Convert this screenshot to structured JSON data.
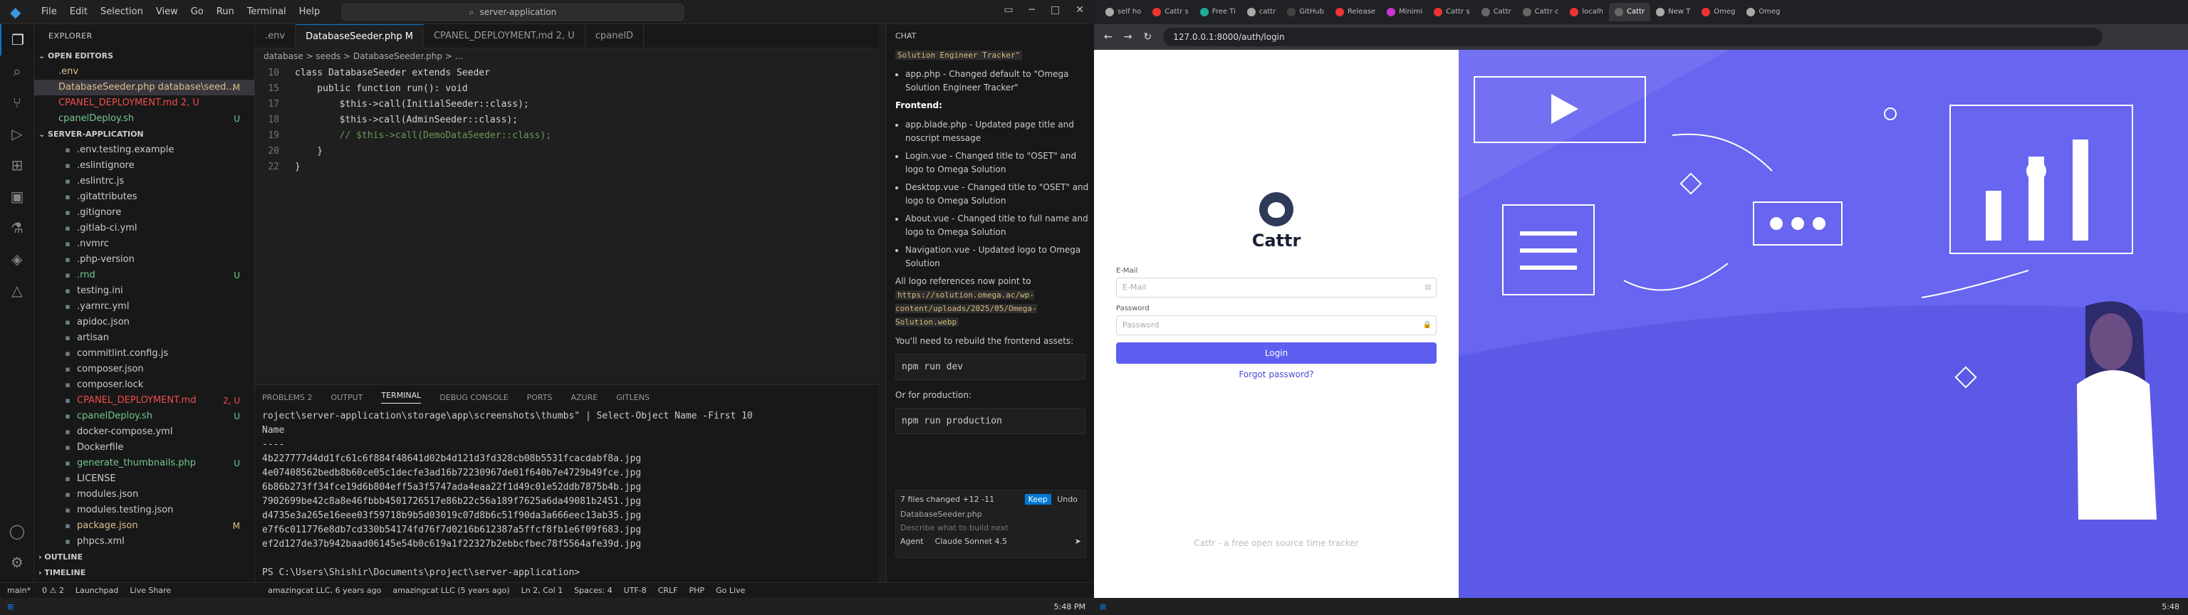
{
  "vscode": {
    "search": "server-application",
    "menu": [
      "File",
      "Edit",
      "Selection",
      "View",
      "Go",
      "Run",
      "Terminal",
      "Help"
    ],
    "explorer_title": "EXPLORER",
    "open_editors_label": "OPEN EDITORS",
    "open_editors": [
      {
        "name": ".env",
        "badge": "",
        "color": "#e2c08d"
      },
      {
        "name": "DatabaseSeeder.php database\\seed...",
        "badge": "M",
        "color": "#e2c08d",
        "selected": true
      },
      {
        "name": "CPANEL_DEPLOYMENT.md 2, U",
        "badge": "",
        "color": "#f14c4c"
      },
      {
        "name": "cpanelDeploy.sh",
        "badge": "U",
        "color": "#73c991"
      }
    ],
    "project_label": "SERVER-APPLICATION",
    "files": [
      {
        "name": ".env.testing.example",
        "badge": "",
        "color": "#ccc"
      },
      {
        "name": ".eslintignore",
        "badge": "",
        "color": "#ccc"
      },
      {
        "name": ".eslintrc.js",
        "badge": "",
        "color": "#ccc"
      },
      {
        "name": ".gitattributes",
        "badge": "",
        "color": "#ccc"
      },
      {
        "name": ".gitignore",
        "badge": "",
        "color": "#ccc"
      },
      {
        "name": ".gitlab-ci.yml",
        "badge": "",
        "color": "#ccc"
      },
      {
        "name": ".nvmrc",
        "badge": "",
        "color": "#ccc"
      },
      {
        "name": ".php-version",
        "badge": "",
        "color": "#ccc"
      },
      {
        "name": ".rnd",
        "badge": "U",
        "color": "#73c991"
      },
      {
        "name": "testing.ini",
        "badge": "",
        "color": "#ccc"
      },
      {
        "name": ".yarnrc.yml",
        "badge": "",
        "color": "#ccc"
      },
      {
        "name": "apidoc.json",
        "badge": "",
        "color": "#ccc"
      },
      {
        "name": "artisan",
        "badge": "",
        "color": "#ccc"
      },
      {
        "name": "commitlint.config.js",
        "badge": "",
        "color": "#ccc"
      },
      {
        "name": "composer.json",
        "badge": "",
        "color": "#ccc"
      },
      {
        "name": "composer.lock",
        "badge": "",
        "color": "#ccc"
      },
      {
        "name": "CPANEL_DEPLOYMENT.md",
        "badge": "2, U",
        "color": "#f14c4c"
      },
      {
        "name": "cpanelDeploy.sh",
        "badge": "U",
        "color": "#73c991"
      },
      {
        "name": "docker-compose.yml",
        "badge": "",
        "color": "#ccc"
      },
      {
        "name": "Dockerfile",
        "badge": "",
        "color": "#ccc"
      },
      {
        "name": "generate_thumbnails.php",
        "badge": "U",
        "color": "#73c991"
      },
      {
        "name": "LICENSE",
        "badge": "",
        "color": "#ccc"
      },
      {
        "name": "modules.json",
        "badge": "",
        "color": "#ccc"
      },
      {
        "name": "modules.testing.json",
        "badge": "",
        "color": "#ccc"
      },
      {
        "name": "package.json",
        "badge": "M",
        "color": "#e2c08d"
      },
      {
        "name": "phpcs.xml",
        "badge": "",
        "color": "#ccc"
      }
    ],
    "outline_label": "OUTLINE",
    "timeline_label": "TIMELINE",
    "tabs": [
      {
        "label": ".env",
        "active": false
      },
      {
        "label": "DatabaseSeeder.php M",
        "active": true
      },
      {
        "label": "CPANEL_DEPLOYMENT.md 2, U",
        "active": false
      },
      {
        "label": "cpanelD",
        "active": false
      }
    ],
    "breadcrumb": "database > seeds > DatabaseSeeder.php > ...",
    "code_lines": [
      {
        "n": "10",
        "t": "class DatabaseSeeder extends Seeder"
      },
      {
        "n": "15",
        "t": "    public function run(): void"
      },
      {
        "n": "17",
        "t": "        $this->call(InitialSeeder::class);"
      },
      {
        "n": "18",
        "t": "        $this->call(AdminSeeder::class);"
      },
      {
        "n": "19",
        "t": "        // $this->call(DemoDataSeeder::class);"
      },
      {
        "n": "20",
        "t": "    }"
      },
      {
        "n": "22",
        "t": "}"
      }
    ],
    "panel_tabs": [
      "PROBLEMS 2",
      "OUTPUT",
      "TERMINAL",
      "DEBUG CONSOLE",
      "PORTS",
      "AZURE",
      "GITLENS"
    ],
    "terminal_lines": [
      "roject\\server-application\\storage\\app\\screenshots\\thumbs\" | Select-Object Name -First 10",
      "Name",
      "----",
      "4b227777d4dd1fc61c6f884f48641d02b4d121d3fd328cb08b5531fcacdabf8a.jpg",
      "4e07408562bedb8b60ce05c1decfe3ad16b72230967de01f640b7e4729b49fce.jpg",
      "6b86b273ff34fce19d6b804eff5a3f5747ada4eaa22f1d49c01e52ddb7875b4b.jpg",
      "7902699be42c8a8e46fbbb4501726517e86b22c56a189f7625a6da49081b2451.jpg",
      "d4735e3a265e16eee03f59718b9b5d03019c07d8b6c51f90da3a666eec13ab35.jpg",
      "e7f6c011776e8db7cd330b54174fd76f7d0216b612387a5ffcf8fb1e6f09f683.jpg",
      "ef2d127de37b942baad06145e54b0c619a1f22327b2ebbcfbec78f5564afe39d.jpg",
      "",
      "PS C:\\Users\\Shishir\\Documents\\project\\server-application>"
    ],
    "chat": {
      "title": "CHAT",
      "top_code": "Solution Engineer Tracker\"",
      "top_item": "app.php - Changed default to \"Omega Solution Engineer Tracker\"",
      "frontend_heading": "Frontend:",
      "frontend_items": [
        "app.blade.php - Updated page title and noscript message",
        "Login.vue - Changed title to \"OSET\" and logo to Omega Solution",
        "Desktop.vue - Changed title to \"OSET\" and logo to Omega Solution",
        "About.vue - Changed title to full name and logo to Omega Solution",
        "Navigation.vue - Updated logo to Omega Solution"
      ],
      "logo_note": "All logo references now point to",
      "logo_url": "https://solution.omega.ac/wp-content/uploads/2025/05/Omega-Solution.webp",
      "rebuild_note": "You'll need to rebuild the frontend assets:",
      "cmd1": "npm run dev",
      "production_note": "Or for production:",
      "cmd2": "npm run production",
      "files_changed": "7 files changed +12 -11",
      "keep_label": "Keep",
      "undo_label": "Undo",
      "attached_file": "DatabaseSeeder.php",
      "input_placeholder": "Describe what to build next",
      "agent_label": "Agent",
      "model_label": "Claude Sonnet 4.5"
    },
    "status": {
      "branch": "main*",
      "problems": "0 ⚠ 2",
      "live_share": "Live Share",
      "launchpad": "Launchpad",
      "blame": "amazingcat LLC, 6 years ago",
      "blame2": "amazingcat LLC (5 years ago)",
      "pos": "Ln 2, Col 1",
      "spaces": "Spaces: 4",
      "encoding": "UTF-8",
      "eol": "CRLF",
      "lang": "PHP",
      "golive": "Go Live"
    },
    "clock": "5:48 PM"
  },
  "browser": {
    "tabs": [
      {
        "label": "self ho",
        "color": "#aaa"
      },
      {
        "label": "Cattr s",
        "color": "#e33"
      },
      {
        "label": "Free Ti",
        "color": "#2a9"
      },
      {
        "label": "cattr",
        "color": "#aaa"
      },
      {
        "label": "GitHub",
        "color": "#444"
      },
      {
        "label": "Release",
        "color": "#e33"
      },
      {
        "label": "Minimi",
        "color": "#c3c"
      },
      {
        "label": "Cattr s",
        "color": "#e33"
      },
      {
        "label": "Cattr",
        "color": "#666"
      },
      {
        "label": "Cattr c",
        "color": "#666"
      },
      {
        "label": "localh",
        "color": "#e33"
      },
      {
        "label": "Cattr",
        "color": "#666",
        "active": true
      },
      {
        "label": "New T",
        "color": "#aaa"
      },
      {
        "label": "Omeg",
        "color": "#e33"
      },
      {
        "label": "Omeg",
        "color": "#aaa"
      }
    ],
    "url": "127.0.0.1:8000/auth/login",
    "brand": "Cattr",
    "email_label": "E-Mail",
    "email_placeholder": "E-Mail",
    "password_label": "Password",
    "password_placeholder": "Password",
    "login_button": "Login",
    "forgot_link": "Forgot password?",
    "footer": "Cattr - a free open source time tracker",
    "clock": "5:48"
  }
}
